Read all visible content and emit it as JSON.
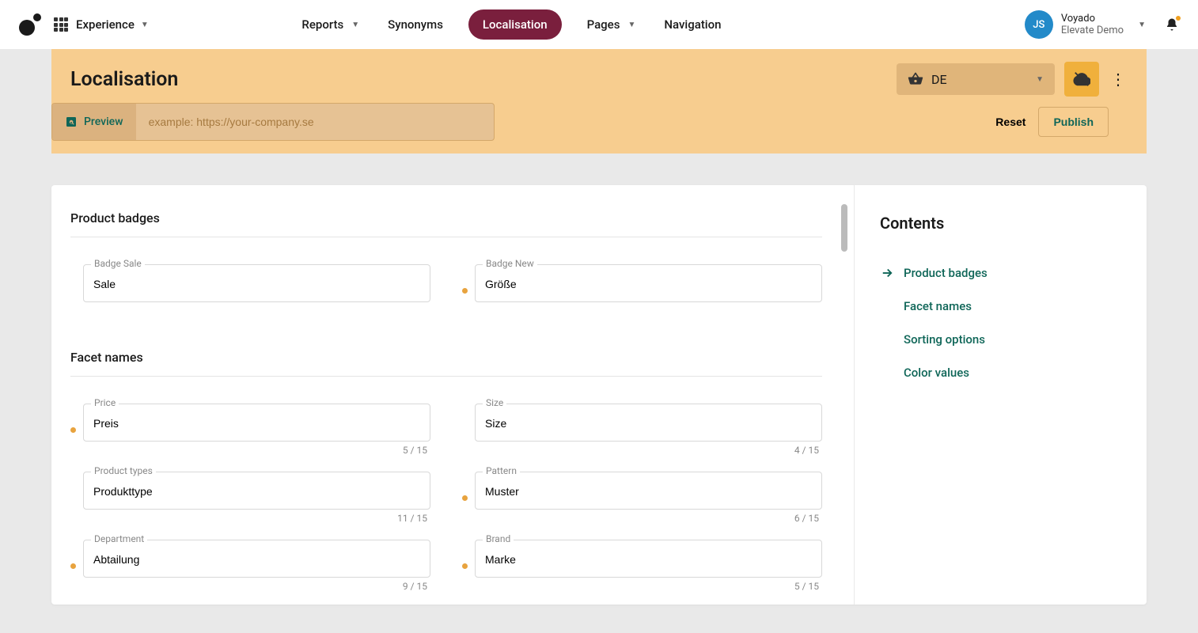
{
  "nav": {
    "experience": "Experience",
    "items": [
      "Reports",
      "Synonyms",
      "Localisation",
      "Pages",
      "Navigation"
    ]
  },
  "account": {
    "initials": "JS",
    "line1": "Voyado",
    "line2": "Elevate Demo"
  },
  "header": {
    "title": "Localisation",
    "locale": "DE",
    "preview": "Preview",
    "url_placeholder": "example: https://your-company.se",
    "reset": "Reset",
    "publish": "Publish"
  },
  "sections": {
    "badges": {
      "title": "Product badges",
      "fields": [
        {
          "label": "Badge Sale",
          "value": "Sale",
          "counter": "",
          "dot": false
        },
        {
          "label": "Badge New",
          "value": "Größe",
          "counter": "",
          "dot": true
        }
      ]
    },
    "facets": {
      "title": "Facet names",
      "fields": [
        {
          "label": "Price",
          "value": "Preis",
          "counter": "5 / 15",
          "dot": true
        },
        {
          "label": "Size",
          "value": "Size",
          "counter": "4 / 15",
          "dot": false
        },
        {
          "label": "Product types",
          "value": "Produkttype",
          "counter": "11 / 15",
          "dot": false
        },
        {
          "label": "Pattern",
          "value": "Muster",
          "counter": "6 / 15",
          "dot": true
        },
        {
          "label": "Department",
          "value": "Abtailung",
          "counter": "9 / 15",
          "dot": true
        },
        {
          "label": "Brand",
          "value": "Marke",
          "counter": "5 / 15",
          "dot": true
        }
      ]
    }
  },
  "sidebar": {
    "title": "Contents",
    "items": [
      "Product badges",
      "Facet names",
      "Sorting options",
      "Color values"
    ]
  }
}
